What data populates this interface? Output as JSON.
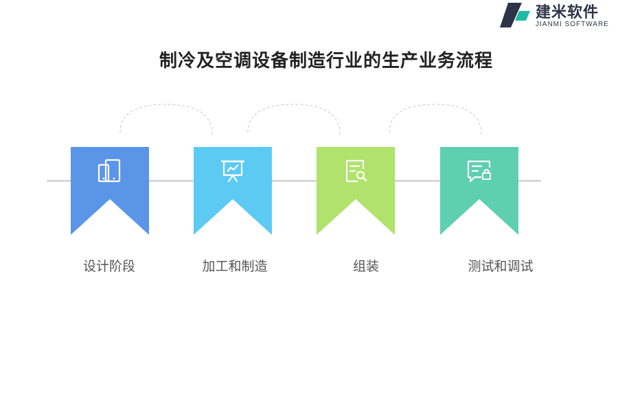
{
  "logo": {
    "name_cn": "建米软件",
    "name_en": "JIANMI SOFTWARE",
    "mark_colors": [
      "#2d3446",
      "#1fb9a5"
    ]
  },
  "title": "制冷及空调设备制造行业的生产业务流程",
  "steps": [
    {
      "label": "设计阶段",
      "color": "#5b95e8",
      "icon": "mobile-devices-icon"
    },
    {
      "label": "加工和制造",
      "color": "#5ccaf3",
      "icon": "presentation-chart-icon"
    },
    {
      "label": "组装",
      "color": "#b0e26c",
      "icon": "document-search-icon"
    },
    {
      "label": "测试和调试",
      "color": "#5ecfb1",
      "icon": "chat-lock-icon"
    }
  ],
  "colors": {
    "line": "#9a9a9a",
    "arc": "#c8c8c8",
    "text": "#555555"
  }
}
